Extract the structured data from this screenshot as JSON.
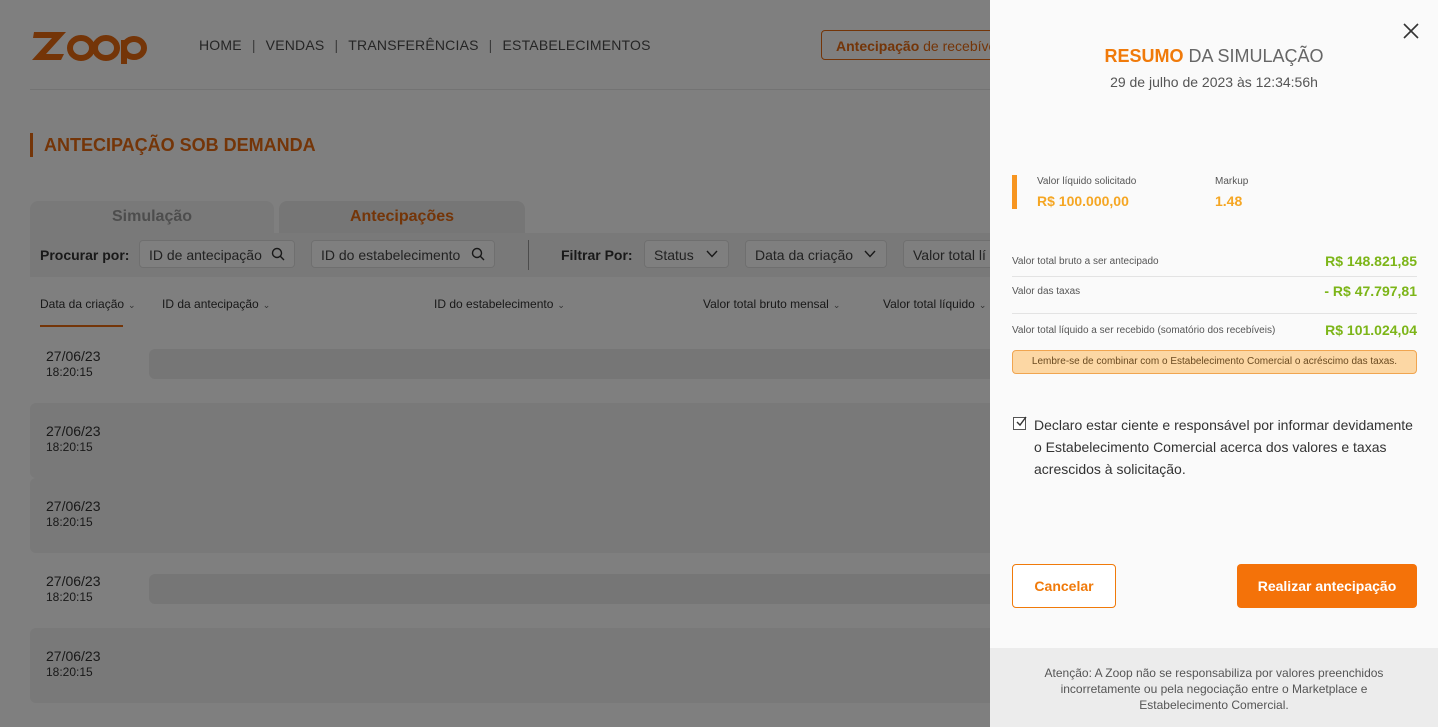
{
  "brand": {
    "logo_text": "Zoop",
    "accent": "#e86a10"
  },
  "nav": {
    "items": [
      "HOME",
      "VENDAS",
      "TRANSFERÊNCIAS",
      "ESTABELECIMENTOS"
    ],
    "separator": "|",
    "antecipacao_bold": "Antecipação",
    "antecipacao_rest": " de recebíve"
  },
  "page_title": "ANTECIPAÇÃO SOB DEMANDA",
  "tabs": [
    {
      "label": "Simulação",
      "active": false
    },
    {
      "label": "Antecipações",
      "active": true
    }
  ],
  "filters": {
    "search_label": "Procurar por:",
    "search_fields": [
      "ID de antecipação",
      "ID do estabelecimento"
    ],
    "filter_label": "Filtrar Por:",
    "filter_fields": [
      "Status",
      "Data da criação",
      "Valor total lí"
    ]
  },
  "table": {
    "columns": [
      "Data da criação",
      "ID da antecipação",
      "ID do estabelecimento",
      "Valor total bruto mensal",
      "Valor total líquido"
    ],
    "rows": [
      {
        "date": "27/06/23",
        "time": "18:20:15"
      },
      {
        "date": "27/06/23",
        "time": "18:20:15"
      },
      {
        "date": "27/06/23",
        "time": "18:20:15"
      },
      {
        "date": "27/06/23",
        "time": "18:20:15"
      },
      {
        "date": "27/06/23",
        "time": "18:20:15"
      }
    ]
  },
  "panel": {
    "title_bold": "RESUMO",
    "title_rest": " DA SIMULAÇÃO",
    "datetime": "29 de julho de 2023 às 12:34:56h",
    "requested_label": "Valor líquido solicitado",
    "requested_value": "R$ 100.000,00",
    "markup_label": "Markup",
    "markup_value": "1.48",
    "gross_label": "Valor total bruto a ser antecipado",
    "gross_value": "R$ 148.821,85",
    "fees_label": "Valor das taxas",
    "fees_value": "- R$ 47.797,81",
    "net_label": "Valor total líquido a ser recebido (somatório dos recebíveis)",
    "net_value": "R$ 101.024,04",
    "notice": "Lembre-se de combinar com o Estabelecimento Comercial o acréscimo das taxas.",
    "declaration": "Declaro estar ciente e responsável por informar devidamente o Estabelecimento Comercial acerca dos valores e taxas acrescidos à solicitação.",
    "declaration_checked": true,
    "cancel_label": "Cancelar",
    "confirm_label": "Realizar antecipação",
    "footer_text": "Atenção: A Zoop não se responsabiliza por valores preenchidos incorretamente ou pela negociação entre o Marketplace e Estabelecimento Comercial."
  },
  "icons": {
    "search": "search-icon",
    "chevron": "chevron-down-icon",
    "close": "close-icon",
    "check": "check-icon"
  }
}
